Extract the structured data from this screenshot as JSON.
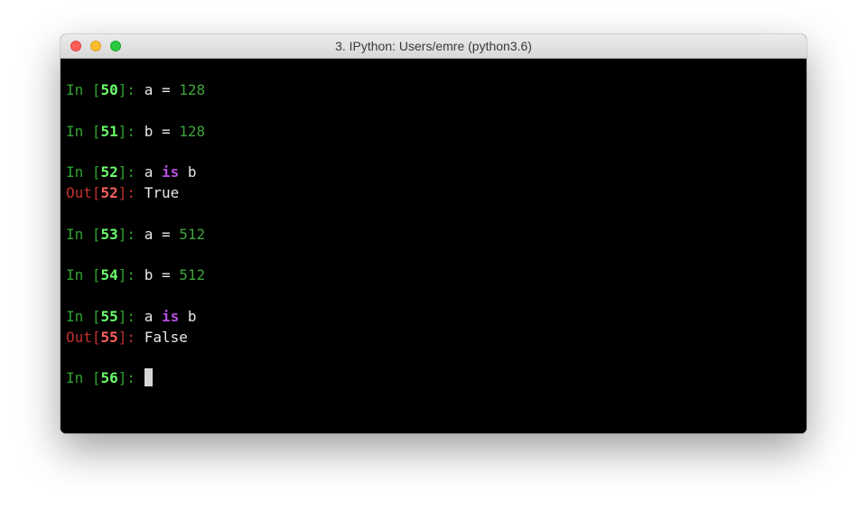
{
  "window": {
    "title": "3. IPython: Users/emre (python3.6)",
    "controls": [
      "close",
      "minimize",
      "zoom"
    ]
  },
  "terminal": {
    "cells": [
      {
        "n": "50",
        "code": [
          {
            "t": "a = ",
            "k": "txt"
          },
          {
            "t": "128",
            "k": "num"
          }
        ]
      },
      {
        "n": "51",
        "code": [
          {
            "t": "b = ",
            "k": "txt"
          },
          {
            "t": "128",
            "k": "num"
          }
        ]
      },
      {
        "n": "52",
        "code": [
          {
            "t": "a ",
            "k": "txt"
          },
          {
            "t": "is",
            "k": "kw"
          },
          {
            "t": " b",
            "k": "txt"
          }
        ],
        "out": "True"
      },
      {
        "n": "53",
        "code": [
          {
            "t": "a = ",
            "k": "txt"
          },
          {
            "t": "512",
            "k": "num"
          }
        ]
      },
      {
        "n": "54",
        "code": [
          {
            "t": "b = ",
            "k": "txt"
          },
          {
            "t": "512",
            "k": "num"
          }
        ]
      },
      {
        "n": "55",
        "code": [
          {
            "t": "a ",
            "k": "txt"
          },
          {
            "t": "is",
            "k": "kw"
          },
          {
            "t": " b",
            "k": "txt"
          }
        ],
        "out": "False"
      }
    ],
    "prompt": {
      "n": "56"
    },
    "in_label": "In",
    "out_label": "Out"
  },
  "colors": {
    "background": "#000000",
    "in_prompt": "#2ea32e",
    "in_number": "#6bff6b",
    "out_prompt": "#c23030",
    "out_number": "#ff5f5f",
    "number_literal": "#3da33d",
    "keyword": "#b54fe0",
    "text": "#e8e8e8"
  }
}
